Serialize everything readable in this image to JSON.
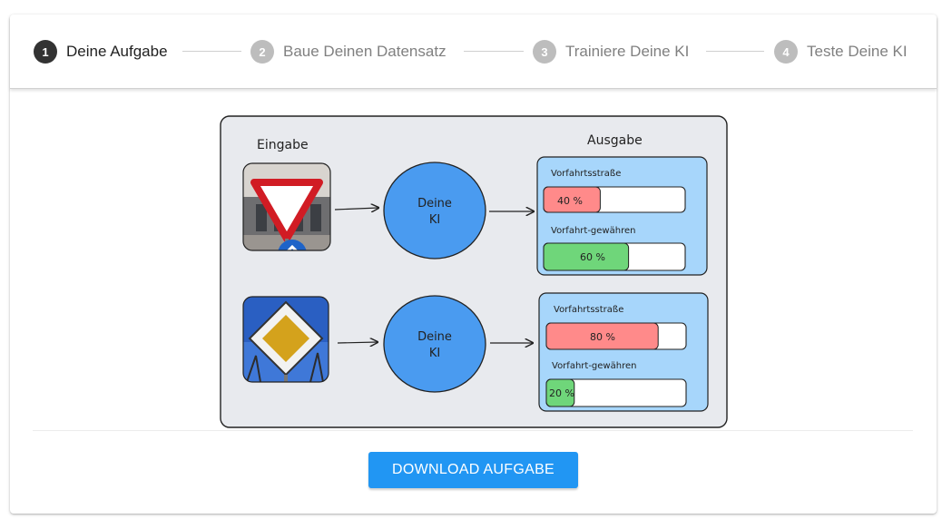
{
  "stepper": {
    "steps": [
      {
        "number": "1",
        "label": "Deine Aufgabe",
        "active": true
      },
      {
        "number": "2",
        "label": "Baue Deinen Datensatz",
        "active": false
      },
      {
        "number": "3",
        "label": "Trainiere Deine KI",
        "active": false
      },
      {
        "number": "4",
        "label": "Teste Deine KI",
        "active": false
      }
    ]
  },
  "illustration": {
    "input_title": "Eingabe",
    "output_title": "Ausgabe",
    "ai_label_line1": "Deine",
    "ai_label_line2": "KI",
    "examples": [
      {
        "image_icon": "yield-sign-photo",
        "outputs": [
          {
            "label": "Vorfahrtsstraße",
            "value_text": "40 %",
            "fraction": 0.4,
            "color": "#ff8a8a"
          },
          {
            "label": "Vorfahrt-gewähren",
            "value_text": "60 %",
            "fraction": 0.6,
            "color": "#6fd67a"
          }
        ]
      },
      {
        "image_icon": "priority-road-sign-photo",
        "outputs": [
          {
            "label": "Vorfahrtsstraße",
            "value_text": "80 %",
            "fraction": 0.8,
            "color": "#ff8a8a"
          },
          {
            "label": "Vorfahrt-gewähren",
            "value_text": "20 %",
            "fraction": 0.2,
            "color": "#6fd67a"
          }
        ]
      }
    ]
  },
  "actions": {
    "download_label": "DOWNLOAD AUFGABE"
  }
}
